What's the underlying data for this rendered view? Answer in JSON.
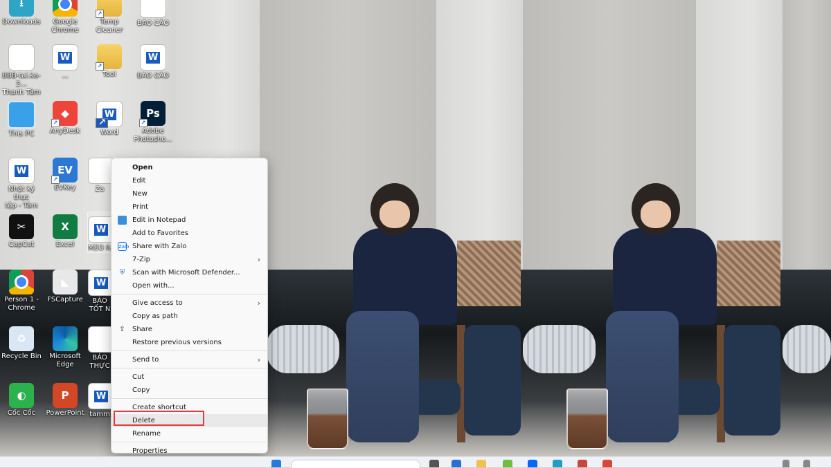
{
  "desktop_icons": [
    {
      "label": "Downloads",
      "icon": "download-icon"
    },
    {
      "label": "Google\nChrome",
      "icon": "chrome-icon"
    },
    {
      "label": "Temp Cleaner",
      "icon": "folder-icon"
    },
    {
      "label": "BÁO CÁO",
      "icon": "document-icon"
    },
    {
      "label": "BBB-tai.ka-2...\nThanh Tâm",
      "icon": "document-icon"
    },
    {
      "label": "...",
      "icon": "word-icon"
    },
    {
      "label": "Tool",
      "icon": "folder-icon"
    },
    {
      "label": "BÁO CÁO",
      "icon": "word-icon"
    },
    {
      "label": "This PC",
      "icon": "computer-icon"
    },
    {
      "label": "AnyDesk",
      "icon": "anydesk-icon"
    },
    {
      "label": "Word",
      "icon": "word-icon"
    },
    {
      "label": "Adobe\nPhotosho...",
      "icon": "photoshop-icon"
    },
    {
      "label": "Nhật ký thực\ntập - Tâm",
      "icon": "word-icon"
    },
    {
      "label": "EVKey",
      "icon": "evkey-icon"
    },
    {
      "label": "Za",
      "icon": "zalo-icon"
    },
    {
      "label": "CapCut",
      "icon": "capcut-icon"
    },
    {
      "label": "Excel",
      "icon": "excel-icon"
    },
    {
      "label": "MEO IU",
      "icon": "word-icon"
    },
    {
      "label": "Person 1 -\nChrome",
      "icon": "chrome-icon"
    },
    {
      "label": "FSCapture",
      "icon": "fscapture-icon"
    },
    {
      "label": "BÁO\nTỐT N",
      "icon": "word-icon"
    },
    {
      "label": "Recycle Bin",
      "icon": "recycle-bin-icon"
    },
    {
      "label": "Microsoft\nEdge",
      "icon": "edge-icon"
    },
    {
      "label": "BÁO\nTHỰC",
      "icon": "document-icon"
    },
    {
      "label": "Cốc Cốc",
      "icon": "coccoc-icon"
    },
    {
      "label": "PowerPoint",
      "icon": "powerpoint-icon"
    },
    {
      "label": "tamm",
      "icon": "word-icon"
    }
  ],
  "context_menu": {
    "open": "Open",
    "edit": "Edit",
    "new": "New",
    "print": "Print",
    "edit_in_notepad": "Edit in Notepad",
    "add_to_favorites": "Add to Favorites",
    "share_with_zalo": "Share with Zalo",
    "seven_zip": "7-Zip",
    "scan_defender": "Scan with Microsoft Defender...",
    "open_with": "Open with...",
    "give_access": "Give access to",
    "copy_as_path": "Copy as path",
    "share": "Share",
    "restore_versions": "Restore previous versions",
    "send_to": "Send to",
    "cut": "Cut",
    "copy": "Copy",
    "create_shortcut": "Create shortcut",
    "delete": "Delete",
    "rename": "Rename",
    "properties": "Properties"
  },
  "colors": {
    "highlight_box": "#e8383d",
    "menu_bg": "#f9f9f9"
  }
}
